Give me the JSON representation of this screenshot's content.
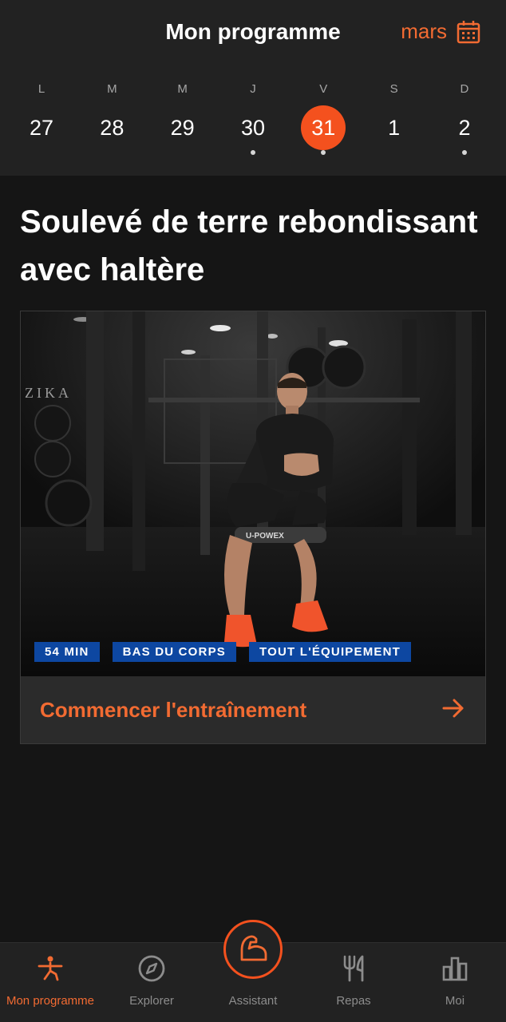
{
  "header": {
    "title": "Mon programme",
    "month_label": "mars"
  },
  "week": {
    "days": [
      {
        "weekday": "L",
        "number": "27",
        "dot": false,
        "selected": false
      },
      {
        "weekday": "M",
        "number": "28",
        "dot": false,
        "selected": false
      },
      {
        "weekday": "M",
        "number": "29",
        "dot": false,
        "selected": false
      },
      {
        "weekday": "J",
        "number": "30",
        "dot": true,
        "selected": false
      },
      {
        "weekday": "V",
        "number": "31",
        "dot": true,
        "selected": true
      },
      {
        "weekday": "S",
        "number": "1",
        "dot": false,
        "selected": false
      },
      {
        "weekday": "D",
        "number": "2",
        "dot": true,
        "selected": false
      }
    ]
  },
  "workout": {
    "title": "Soulevé de terre rebondissant avec haltère",
    "tags": [
      "54 MIN",
      "BAS DU CORPS",
      "TOUT L'ÉQUIPEMENT"
    ],
    "start_label": "Commencer l'entraînement",
    "image_wall_text": "ZIKA",
    "image_band_text": "U-POWEX"
  },
  "tabbar": {
    "items": [
      {
        "label": "Mon programme",
        "icon": "person-exercise-icon",
        "active": true
      },
      {
        "label": "Explorer",
        "icon": "compass-icon",
        "active": false
      },
      {
        "label": "Assistant",
        "icon": "flexed-arm-icon",
        "active": false
      },
      {
        "label": "Repas",
        "icon": "fork-knife-icon",
        "active": false
      },
      {
        "label": "Moi",
        "icon": "bar-chart-icon",
        "active": false
      }
    ]
  },
  "colors": {
    "accent": "#f26b32",
    "selected_day": "#f4511e",
    "tag_background": "#0d47a1",
    "background": "#151515",
    "header_background": "#222222"
  }
}
